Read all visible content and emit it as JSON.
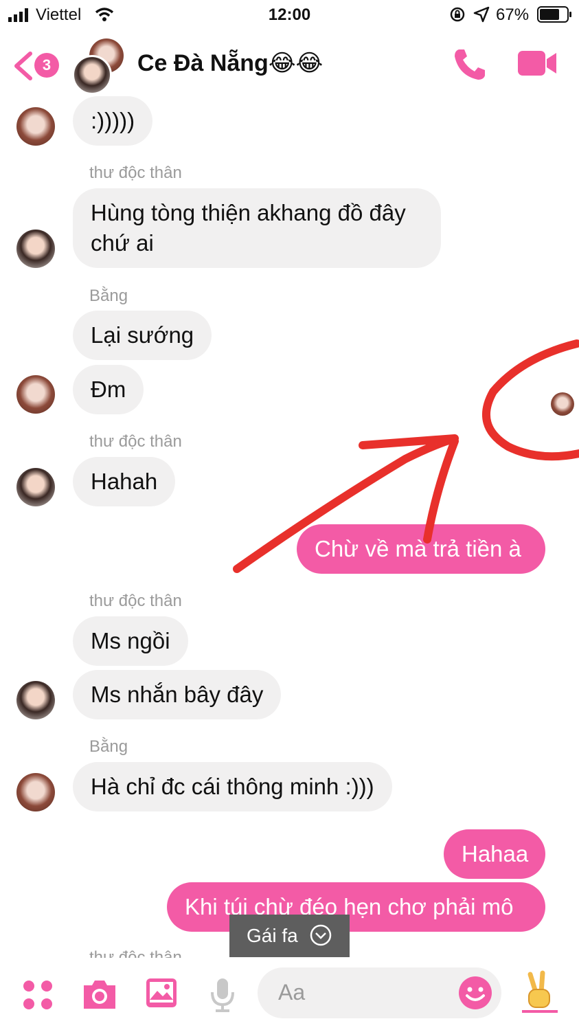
{
  "status_bar": {
    "carrier": "Viettel",
    "time": "12:00",
    "battery": "67%"
  },
  "header": {
    "unread_count": "3",
    "title": "Ce Đà Nẵng😂😂"
  },
  "messages": [
    {
      "text": ":)))))"
    },
    {
      "sender": "thư độc thân",
      "line1": "Hùng tòng thiện akhang đồ đây",
      "line2": "chứ ai"
    },
    {
      "sender": "Bằng",
      "text": "Lại sướng"
    },
    {
      "text": "Đm"
    },
    {
      "sender": "thư độc thân",
      "text": "Hahah"
    },
    {
      "text": "Chừ về mà trả tiền à"
    },
    {
      "sender": "thư độc thân",
      "text": "Ms ngồi"
    },
    {
      "text": "Ms nhắn bây đây"
    },
    {
      "sender": "Bằng",
      "text": "Hà chỉ đc cái thông minh :)))"
    },
    {
      "text": "Hahaa"
    },
    {
      "text": "Khi túi chừ đéo hẹn chơ phải mô"
    },
    {
      "sender": "thư độc thân"
    }
  ],
  "composer": {
    "placeholder": "Aa"
  },
  "toast": {
    "label": "Gái fa"
  },
  "colors": {
    "accent": "#f35ba6",
    "annotation": "#e8302b",
    "incoming_bubble": "#f1f0f0"
  }
}
